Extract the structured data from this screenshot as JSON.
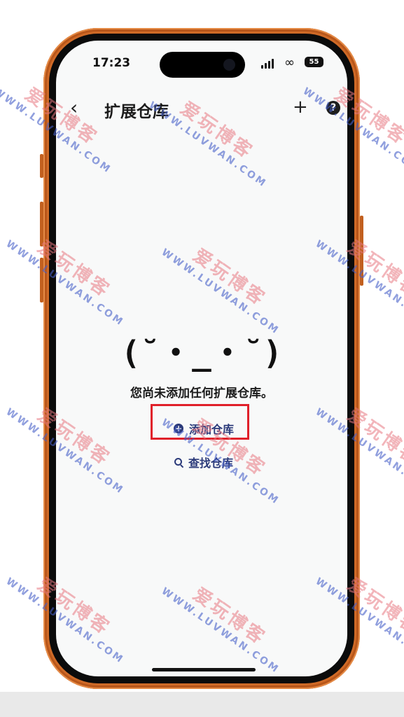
{
  "status_bar": {
    "time": "17:23",
    "battery": "55"
  },
  "header": {
    "title": "扩展仓库",
    "back_icon": "chevron-left-icon",
    "add_icon": "plus-icon",
    "help_icon": "help-icon"
  },
  "empty_state": {
    "kaomoji": "(˘・_・˘)",
    "message": "您尚未添加任何扩展仓库。",
    "add_repo_label": "添加仓库",
    "find_repo_label": "查找仓库"
  },
  "watermark": {
    "cn": "爱玩博客",
    "en": "WWW.LUVWAN.COM"
  },
  "colors": {
    "accent": "#2b3a7a",
    "frame": "#cf6a27",
    "highlight": "#e0202a"
  }
}
